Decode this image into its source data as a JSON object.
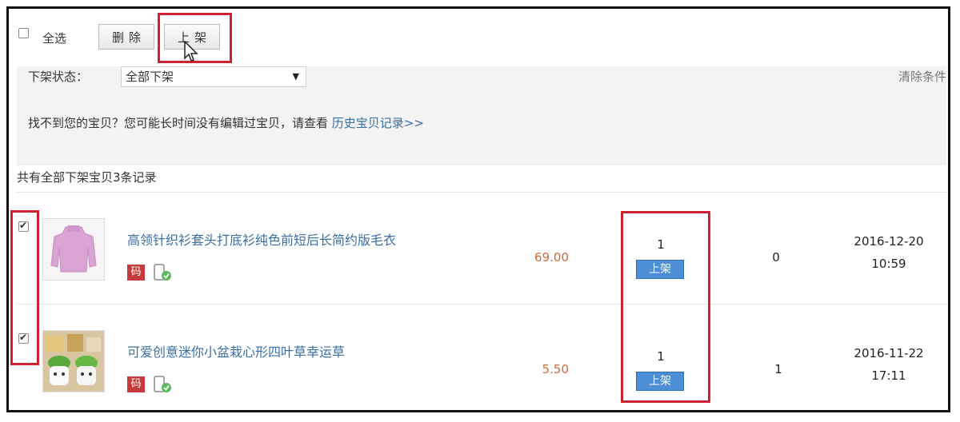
{
  "toolbar": {
    "select_all_label": "全选",
    "delete_label": "删除",
    "list_label": "上架"
  },
  "filter": {
    "status_label": "下架状态：",
    "status_value": "全部下架",
    "clear_label": "清除条件",
    "notice_text": "找不到您的宝贝？您可能长时间没有编辑过宝贝，请查看",
    "history_link": "历史宝贝记录>>"
  },
  "summary": "共有全部下架宝贝3条记录",
  "items": [
    {
      "title": "高领针织衫套头打底衫纯色前短后长简约版毛衣",
      "code_badge": "码",
      "price": "69.00",
      "quantity": "1",
      "action": "上架",
      "sold": "0",
      "date": "2016-12-20",
      "time": "10:59",
      "checked": true
    },
    {
      "title": "可爱创意迷你小盆栽心形四叶草幸运草",
      "code_badge": "码",
      "price": "5.50",
      "quantity": "1",
      "action": "上架",
      "sold": "1",
      "date": "2016-11-22",
      "time": "17:11",
      "checked": true
    }
  ],
  "colors": {
    "highlight_box": "#cc2233",
    "link": "#3a6ea5",
    "price": "#d06a3c",
    "action_button": "#4d8fd6",
    "panel_bg": "#f3f3f3"
  }
}
